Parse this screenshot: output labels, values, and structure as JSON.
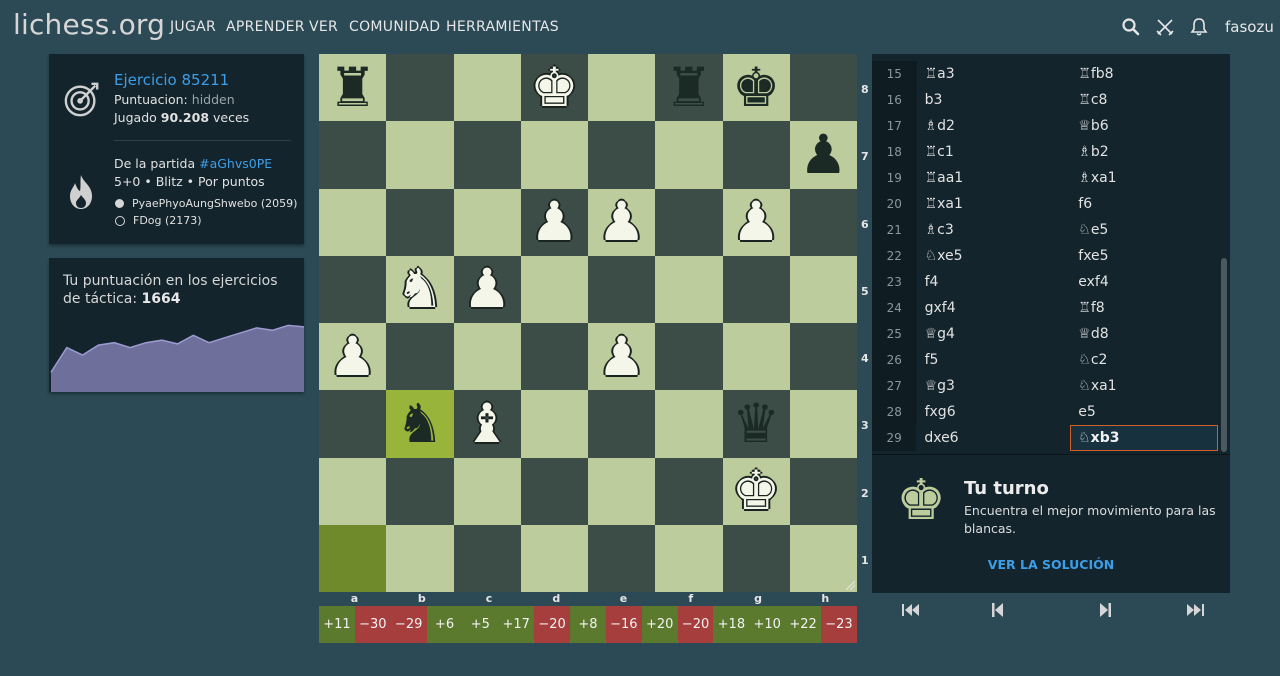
{
  "nav": {
    "logo": "lichess.org",
    "items": [
      "JUGAR",
      "APRENDER",
      "VER",
      "COMUNIDAD",
      "HERRAMIENTAS"
    ],
    "username": "fasozu",
    "icons": [
      "search-icon",
      "swords-icon",
      "bell-icon"
    ]
  },
  "puzzle": {
    "title": "Ejercicio 85211",
    "rating_label": "Puntuacion:",
    "rating_value": "hidden",
    "played_prefix": "Jugado",
    "played_count": "90.208",
    "played_suffix": "veces",
    "icon": "target-icon"
  },
  "game": {
    "from_label": "De la partida",
    "game_id": "#aGhvs0PE",
    "mode": "5+0 • Blitz • Por puntos",
    "white_player": "PyaePhyoAungShwebo (2059)",
    "black_player": "FDog (2173)",
    "icon": "flame-icon"
  },
  "rating_panel": {
    "text": "Tu puntuación en los ejercicios de táctica:",
    "rating": "1664",
    "history": [
      1480,
      1580,
      1550,
      1590,
      1600,
      1580,
      1600,
      1610,
      1595,
      1630,
      1600,
      1620,
      1640,
      1660,
      1650,
      1670,
      1664
    ]
  },
  "board": {
    "ranks": [
      "8",
      "7",
      "6",
      "5",
      "4",
      "3",
      "2",
      "1"
    ],
    "files": [
      "a",
      "b",
      "c",
      "d",
      "e",
      "f",
      "g",
      "h"
    ],
    "rows": [
      [
        "bR",
        "",
        "",
        "wK*",
        "",
        "bR",
        "bK",
        ""
      ],
      [
        "",
        "",
        "",
        "",
        "",
        "",
        "",
        "bP"
      ],
      [
        "",
        "",
        "",
        "wP",
        "wP",
        "",
        "wP",
        ""
      ],
      [
        "",
        "wN",
        "wP",
        "",
        "",
        "",
        "",
        ""
      ],
      [
        "wP",
        "",
        "",
        "",
        "wP",
        "",
        "",
        ""
      ],
      [
        "",
        "bN*",
        "wB",
        "",
        "",
        "",
        "bQ",
        ""
      ],
      [
        "",
        "",
        "",
        "",
        "",
        "",
        "wK",
        ""
      ],
      [
        "#",
        "",
        "",
        "",
        "",
        "",
        "",
        ""
      ]
    ]
  },
  "deltas": [
    "+11",
    "−30",
    "−29",
    "+6",
    "+5",
    "+17",
    "−20",
    "+8",
    "−16",
    "+20",
    "−20",
    "+18",
    "+10",
    "+22",
    "−23"
  ],
  "moves": [
    {
      "n": "15",
      "w": "♖a3",
      "b": "♖fb8"
    },
    {
      "n": "16",
      "w": "b3",
      "b": "♖c8"
    },
    {
      "n": "17",
      "w": "♗d2",
      "b": "♕b6"
    },
    {
      "n": "18",
      "w": "♖c1",
      "b": "♗b2"
    },
    {
      "n": "19",
      "w": "♖aa1",
      "b": "♗xa1"
    },
    {
      "n": "20",
      "w": "♖xa1",
      "b": "f6"
    },
    {
      "n": "21",
      "w": "♗c3",
      "b": "♘e5"
    },
    {
      "n": "22",
      "w": "♘xe5",
      "b": "fxe5"
    },
    {
      "n": "23",
      "w": "f4",
      "b": "exf4"
    },
    {
      "n": "24",
      "w": "gxf4",
      "b": "♖f8"
    },
    {
      "n": "25",
      "w": "♕g4",
      "b": "♕d8"
    },
    {
      "n": "26",
      "w": "f5",
      "b": "♘c2"
    },
    {
      "n": "27",
      "w": "♕g3",
      "b": "♘xa1"
    },
    {
      "n": "28",
      "w": "fxg6",
      "b": "e5"
    },
    {
      "n": "29",
      "w": "dxe6",
      "b": "♘xb3"
    }
  ],
  "turn": {
    "title": "Tu turno",
    "text": "Encuentra el mejor movimiento para las blancas.",
    "solution": "VER LA SOLUCIÓN",
    "icon": "white-king-icon"
  },
  "controls": [
    "first-move-icon",
    "prev-move-icon",
    "next-move-icon",
    "last-move-icon"
  ]
}
